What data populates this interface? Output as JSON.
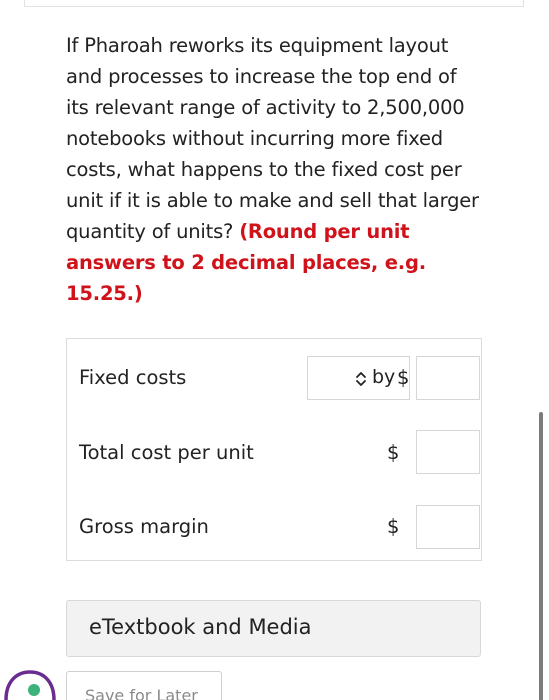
{
  "question": {
    "lines": [
      "If Pharoah reworks its equipment layout",
      "and processes to increase the top end of",
      "its relevant range of activity to 2,500,000",
      "notebooks without incurring more fixed",
      "costs, what happens to the fixed cost per",
      "unit if it is able to make and sell that larger"
    ],
    "last_line_plain": "quantity of units? ",
    "highlight_lines": [
      "(Round per unit",
      "answers to 2 decimal places, e.g.",
      "15.25.)"
    ]
  },
  "colors": {
    "highlight": "#d0131b",
    "text": "#222222",
    "border": "#dcdcdc"
  },
  "answers": {
    "rows": [
      {
        "label": "Fixed costs",
        "select_value": "by",
        "currency": "$",
        "value": ""
      },
      {
        "label": "Total cost per unit",
        "currency": "$",
        "value": ""
      },
      {
        "label": "Gross margin",
        "currency": "$",
        "value": ""
      }
    ]
  },
  "etextbook": {
    "label": "eTextbook and Media"
  },
  "save": {
    "label": "Save for Later"
  },
  "icons": {
    "select": "chevron-up-down-icon",
    "help": "chat-help-icon"
  }
}
